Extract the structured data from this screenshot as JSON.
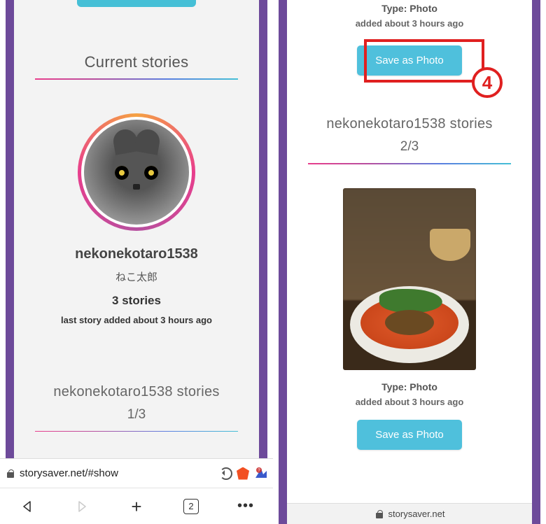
{
  "left": {
    "section_title": "Current stories",
    "profile": {
      "username": "nekonekotaro1538",
      "display_name": "ねこ太郎",
      "story_count_label": "3 stories",
      "last_added": "last story added about 3 hours ago"
    },
    "stories_header": "nekonekotaro1538 stories",
    "stories_index": "1/3",
    "address_bar": {
      "url": "storysaver.net/#show"
    },
    "nav": {
      "tab_count": "2"
    }
  },
  "right": {
    "top_story": {
      "type_label": "Type: Photo",
      "added_label": "added about 3 hours ago",
      "save_label": "Save as Photo"
    },
    "callout_number": "4",
    "stories_header": "nekonekotaro1538 stories",
    "stories_index": "2/3",
    "story2": {
      "type_label": "Type: Photo",
      "added_label": "added about 3 hours ago",
      "save_label": "Save as Photo"
    },
    "bottom_bar_host": "storysaver.net"
  }
}
